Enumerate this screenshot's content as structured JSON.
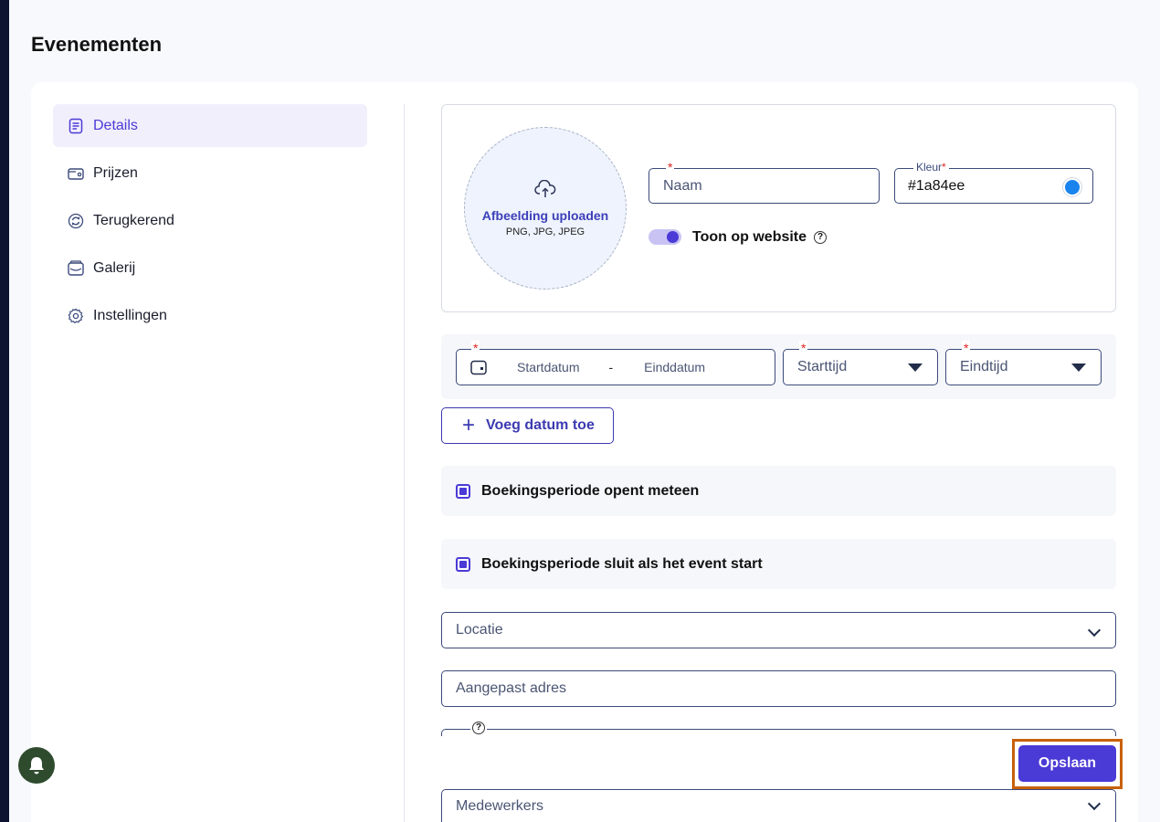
{
  "page": {
    "title": "Evenementen"
  },
  "sidebar": {
    "items": [
      {
        "label": "Details",
        "icon": "document-icon",
        "active": true
      },
      {
        "label": "Prijzen",
        "icon": "wallet-icon",
        "active": false
      },
      {
        "label": "Terugkerend",
        "icon": "recurring-icon",
        "active": false
      },
      {
        "label": "Galerij",
        "icon": "gallery-icon",
        "active": false
      },
      {
        "label": "Instellingen",
        "icon": "gear-icon",
        "active": false
      }
    ]
  },
  "upload": {
    "title": "Afbeelding uploaden",
    "formats": "PNG, JPG, JPEG",
    "icon": "cloud-upload-icon"
  },
  "form": {
    "name": {
      "placeholder": "Naam",
      "value": "",
      "required_mark": "*"
    },
    "color": {
      "label": "Kleur",
      "value": "#1a84ee",
      "required_mark": "*",
      "swatch": "#1a84ee"
    },
    "show_on_website": {
      "label": "Toon op website",
      "enabled": true,
      "help": "?"
    },
    "dates": {
      "required_mark": "*",
      "start_placeholder": "Startdatum",
      "separator": "-",
      "end_placeholder": "Einddatum",
      "start_time_placeholder": "Starttijd",
      "end_time_placeholder": "Eindtijd"
    },
    "add_date_label": "Voeg datum toe",
    "booking_opens_now": {
      "label": "Boekingsperiode opent meteen",
      "checked": true
    },
    "booking_closes_at_start": {
      "label": "Boekingsperiode sluit als het event start",
      "checked": true
    },
    "location": {
      "placeholder": "Locatie"
    },
    "custom_address": {
      "placeholder": "Aangepast adres"
    },
    "cut_help": "?",
    "staff": {
      "placeholder": "Medewerkers"
    }
  },
  "actions": {
    "save_label": "Opslaan"
  },
  "colors": {
    "accent": "#4a3ad6",
    "highlight": "#c8600a",
    "bell_bg": "#2f4b2e"
  }
}
